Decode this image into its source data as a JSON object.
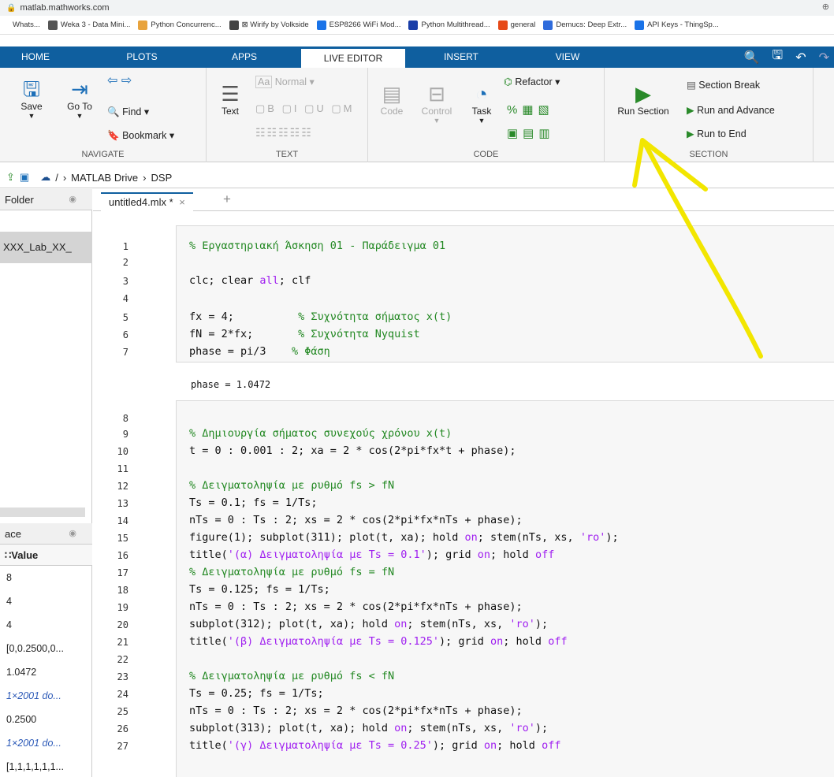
{
  "browser": {
    "url": "matlab.mathworks.com"
  },
  "bookmarks": [
    {
      "label": "Whats...",
      "color": "#ffffff"
    },
    {
      "label": "Weka 3 - Data Mini...",
      "color": "#555555"
    },
    {
      "label": "Python Concurrenc...",
      "color": "#e8a33d"
    },
    {
      "label": "⊠ Wirify by Volkside",
      "color": "#444444"
    },
    {
      "label": "ESP8266 WiFi Mod...",
      "color": "#1a73e8"
    },
    {
      "label": "Python Multithread...",
      "color": "#1a3ea8"
    },
    {
      "label": "general",
      "color": "#e64a19"
    },
    {
      "label": "Demucs: Deep Extr...",
      "color": "#2e6bdc"
    },
    {
      "label": "API Keys - ThingSp...",
      "color": "#1a73e8"
    }
  ],
  "tabs": [
    "HOME",
    "PLOTS",
    "APPS",
    "LIVE EDITOR",
    "INSERT",
    "VIEW"
  ],
  "ribbon": {
    "save": "Save",
    "goto": "Go To",
    "find": "Find",
    "bookmark": "Bookmark",
    "navigate": "NAVIGATE",
    "text": "Text",
    "normal": "Normal",
    "text_group": "TEXT",
    "code": "Code",
    "control": "Control",
    "task": "Task",
    "refactor": "Refactor",
    "code_group": "CODE",
    "run_section": "Run Section",
    "section_break": "Section Break",
    "run_advance": "Run and Advance",
    "run_end": "Run to End",
    "section_group": "SECTION"
  },
  "address": {
    "root": "/",
    "crumb1": "MATLAB Drive",
    "crumb2": "DSP"
  },
  "folder": {
    "title": "Folder",
    "item": "XXX_Lab_XX_"
  },
  "workspace": {
    "title": "ace",
    "value_header": "Value",
    "values": [
      "8",
      "4",
      "4",
      "[0,0.2500,0...",
      "1.0472",
      "1×2001 do...",
      "0.2500",
      "1×2001 do...",
      "[1,1,1,1,1,1..."
    ]
  },
  "editor": {
    "tab": "untitled4.mlx *",
    "output": "phase = 1.0472"
  },
  "lines": {
    "n1": "1",
    "n2": "2",
    "n3": "3",
    "n4": "4",
    "n5": "5",
    "n6": "6",
    "n7": "7",
    "n8": "8",
    "n9": "9",
    "n10": "10",
    "n11": "11",
    "n12": "12",
    "n13": "13",
    "n14": "14",
    "n15": "15",
    "n16": "16",
    "n17": "17",
    "n18": "18",
    "n19": "19",
    "n20": "20",
    "n21": "21",
    "n22": "22",
    "n23": "23",
    "n24": "24",
    "n25": "25",
    "n26": "26",
    "n27": "27",
    "c1": "% Εργαστηριακή Άσκηση 01 - Παράδειγμα 01",
    "c3a": "clc; clear ",
    "c3b": "all",
    "c3c": "; clf",
    "c5a": "fx = 4;          ",
    "c5b": "% Συχνότητα σήματος x(t)",
    "c6a": "fN = 2*fx;       ",
    "c6b": "% Συχνότητα Nyquist",
    "c7a": "phase = pi/3    ",
    "c7b": "% Φάση",
    "c9": "% Δημιουργία σήματος συνεχούς χρόνου x(t)",
    "c10": "t = 0 : 0.001 : 2; xa = 2 * cos(2*pi*fx*t + phase);",
    "c12": "% Δειγματοληψία με ρυθμό fs > fN",
    "c13": "Ts = 0.1; fs = 1/Ts;",
    "c14": "nTs = 0 : Ts : 2; xs = 2 * cos(2*pi*fx*nTs + phase);",
    "c15a": "figure(1); subplot(311); plot(t, xa); hold ",
    "c15b": "on",
    "c15c": "; stem(nTs, xs, ",
    "c15d": "'ro'",
    "c15e": ");",
    "c16a": "title(",
    "c16b": "'(α) Δειγματοληψία με Ts = 0.1'",
    "c16c": "); grid ",
    "c16d": "on",
    "c16e": "; hold ",
    "c16f": "off",
    "c17": "% Δειγματοληψία με ρυθμό fs = fN",
    "c18": "Ts = 0.125; fs = 1/Ts;",
    "c19": "nTs = 0 : Ts : 2; xs = 2 * cos(2*pi*fx*nTs + phase);",
    "c20a": "subplot(312); plot(t, xa); hold ",
    "c20b": "on",
    "c20c": "; stem(nTs, xs, ",
    "c20d": "'ro'",
    "c20e": ");",
    "c21a": "title(",
    "c21b": "'(β) Δειγματοληψία με Ts = 0.125'",
    "c21c": "); grid ",
    "c21d": "on",
    "c21e": "; hold ",
    "c21f": "off",
    "c23": "% Δειγματοληψία με ρυθμό fs < fN",
    "c24": "Ts = 0.25; fs = 1/Ts;",
    "c25": "nTs = 0 : Ts : 2; xs = 2 * cos(2*pi*fx*nTs + phase);",
    "c26a": "subplot(313); plot(t, xa); hold ",
    "c26b": "on",
    "c26c": "; stem(nTs, xs, ",
    "c26d": "'ro'",
    "c26e": ");",
    "c27a": "title(",
    "c27b": "'(γ) Δειγματοληψία με Ts = 0.25'",
    "c27c": "); grid ",
    "c27d": "on",
    "c27e": "; hold ",
    "c27f": "off"
  }
}
